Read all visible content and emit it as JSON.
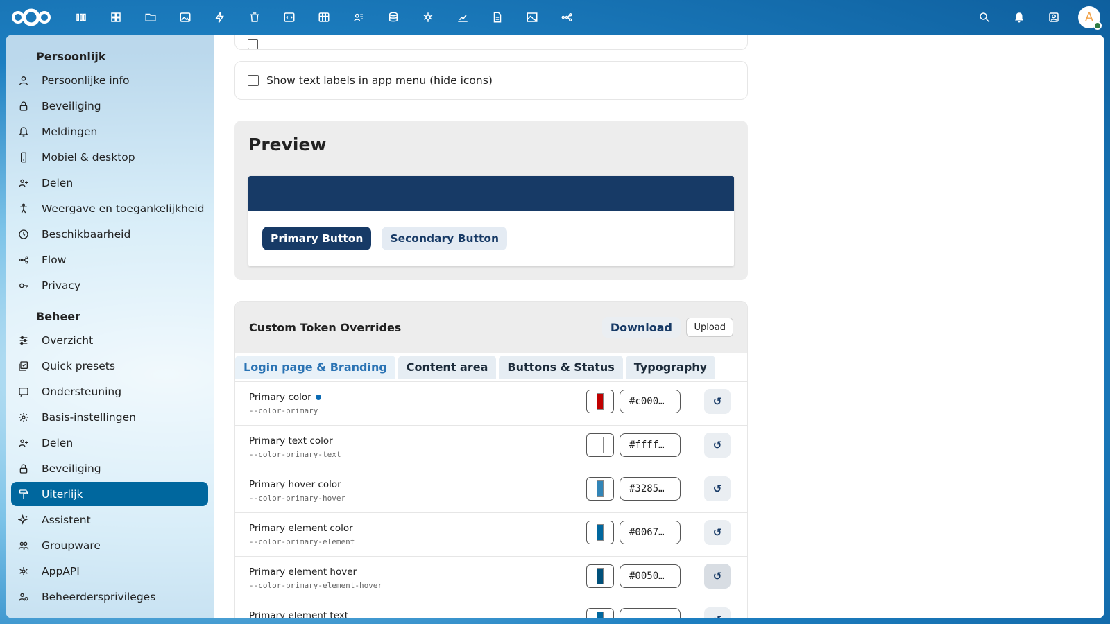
{
  "header": {
    "apps": [
      {
        "name": "dashboard-icon"
      },
      {
        "name": "grid-icon"
      },
      {
        "name": "folder-icon"
      },
      {
        "name": "image-icon"
      },
      {
        "name": "activity-icon"
      },
      {
        "name": "trash-icon"
      },
      {
        "name": "code-icon"
      },
      {
        "name": "table-icon"
      },
      {
        "name": "contacts-icon"
      },
      {
        "name": "database-icon"
      },
      {
        "name": "bug-icon"
      },
      {
        "name": "chart-icon"
      },
      {
        "name": "document-icon"
      },
      {
        "name": "picture-icon"
      },
      {
        "name": "flow-icon"
      }
    ],
    "avatar_initial": "A"
  },
  "sidebar": {
    "personal_caption": "Persoonlijk",
    "personal": [
      {
        "label": "Persoonlijke info",
        "icon": "user-icon"
      },
      {
        "label": "Beveiliging",
        "icon": "lock-icon"
      },
      {
        "label": "Meldingen",
        "icon": "bell-icon"
      },
      {
        "label": "Mobiel & desktop",
        "icon": "phone-icon"
      },
      {
        "label": "Delen",
        "icon": "share-icon"
      },
      {
        "label": "Weergave en toegankelijkheid",
        "icon": "accessibility-icon"
      },
      {
        "label": "Beschikbaarheid",
        "icon": "clock-icon"
      },
      {
        "label": "Flow",
        "icon": "flow-icon"
      },
      {
        "label": "Privacy",
        "icon": "key-icon"
      }
    ],
    "admin_caption": "Beheer",
    "admin": [
      {
        "label": "Overzicht",
        "icon": "sliders-icon"
      },
      {
        "label": "Quick presets",
        "icon": "presets-icon"
      },
      {
        "label": "Ondersteuning",
        "icon": "support-icon"
      },
      {
        "label": "Basis-instellingen",
        "icon": "gear-icon"
      },
      {
        "label": "Delen",
        "icon": "share-icon"
      },
      {
        "label": "Beveiliging",
        "icon": "lock-icon"
      },
      {
        "label": "Uiterlijk",
        "icon": "paint-icon"
      },
      {
        "label": "Assistent",
        "icon": "sparkle-icon"
      },
      {
        "label": "Groupware",
        "icon": "groups-icon"
      },
      {
        "label": "AppAPI",
        "icon": "api-icon"
      },
      {
        "label": "Beheerdersprivileges",
        "icon": "admin-icon"
      }
    ]
  },
  "main": {
    "show_labels_text": "Show text labels in app menu (hide icons)",
    "preview": {
      "title": "Preview",
      "primary_button": "Primary Button",
      "secondary_button": "Secondary Button",
      "header_color": "#173a66"
    },
    "tokens": {
      "title": "Custom Token Overrides",
      "download": "Download",
      "upload": "Upload",
      "tabs": [
        "Login page & Branding",
        "Content area",
        "Buttons & Status",
        "Typography"
      ],
      "rows": [
        {
          "label": "Primary color",
          "var": "--color-primary",
          "hex": "#c000…",
          "color": "#c00000",
          "modified": true
        },
        {
          "label": "Primary text color",
          "var": "--color-primary-text",
          "hex": "#ffff…",
          "color": "#ffffff",
          "modified": false
        },
        {
          "label": "Primary hover color",
          "var": "--color-primary-hover",
          "hex": "#3285…",
          "color": "#3285b7",
          "modified": false
        },
        {
          "label": "Primary element color",
          "var": "--color-primary-element",
          "hex": "#0067…",
          "color": "#00679e",
          "modified": false
        },
        {
          "label": "Primary element hover",
          "var": "--color-primary-element-hover",
          "hex": "#0050…",
          "color": "#00507a",
          "modified": false
        },
        {
          "label": "Primary element text",
          "var": "",
          "hex": "",
          "color": "#00679e",
          "modified": false
        }
      ]
    }
  }
}
